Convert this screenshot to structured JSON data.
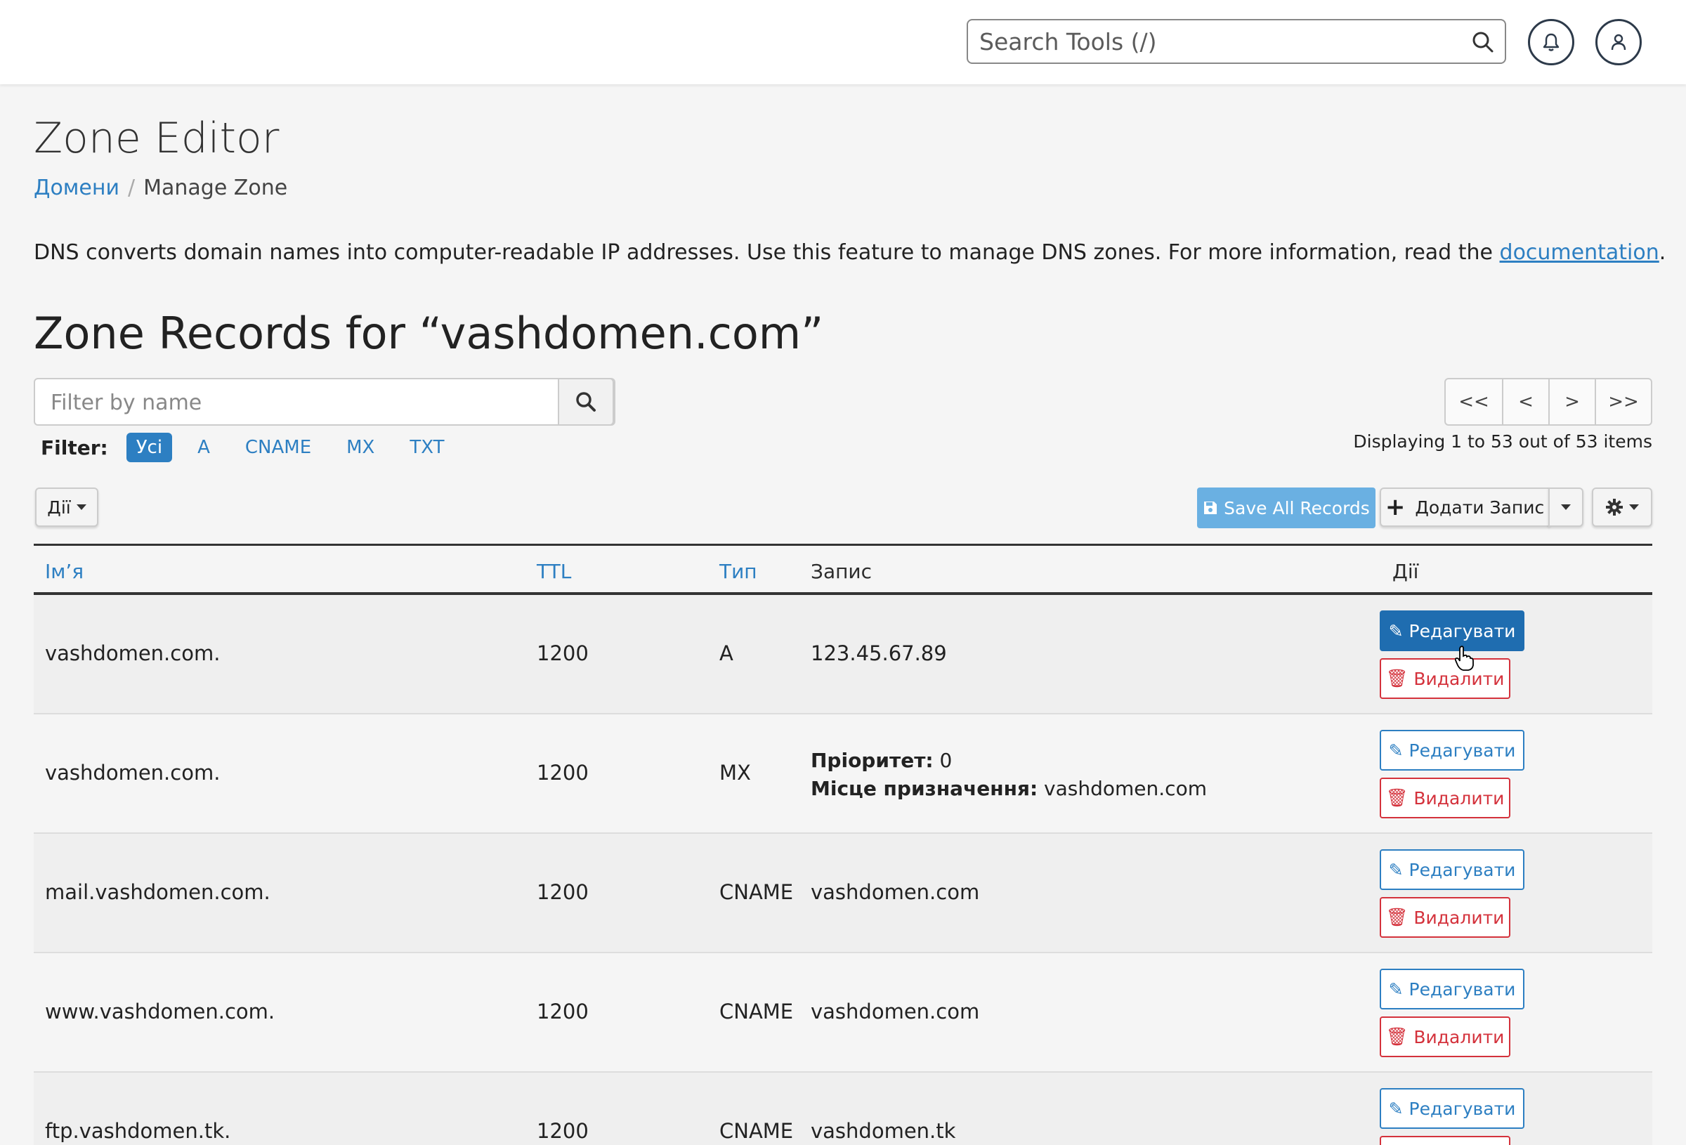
{
  "topbar": {
    "search_placeholder": "Search Tools (/)",
    "search_icon": "search-icon",
    "bell_icon": "bell-icon",
    "user_icon": "user-icon"
  },
  "page": {
    "title": "Zone Editor",
    "breadcrumb": {
      "link": "Домени",
      "separator": "/",
      "current": "Manage Zone"
    },
    "description": "DNS converts domain names into computer-readable IP addresses. Use this feature to manage DNS zones. For more information, read the ",
    "description_link": "documentation",
    "description_end": ".",
    "records_heading": "Zone Records for “vashdomen.com”"
  },
  "filter": {
    "placeholder": "Filter by name",
    "label": "Filter:",
    "pills": [
      "Усі",
      "A",
      "CNAME",
      "MX",
      "TXT"
    ],
    "active_pill": "Усі"
  },
  "pager": {
    "first": "<<",
    "prev": "<",
    "next": ">",
    "last": ">>",
    "displaying": "Displaying 1 to 53 out of 53 items"
  },
  "toolbar": {
    "actions_label": "Дії",
    "save_all": "Save All Records",
    "add_record": "Додати Запис"
  },
  "table": {
    "headers": {
      "name": "Ім’я",
      "ttl": "TTL",
      "type": "Тип",
      "record": "Запис",
      "actions": "Дії"
    },
    "edit_label": "Редагувати",
    "delete_label": "Видалити",
    "rows": [
      {
        "name": "vashdomen.com.",
        "ttl": "1200",
        "type": "A",
        "record": "123.45.67.89"
      },
      {
        "name": "vashdomen.com.",
        "ttl": "1200",
        "type": "MX",
        "priority_label": "Пріоритет:",
        "priority": " 0",
        "dest_label": "Місце призначення:",
        "dest": " vashdomen.com"
      },
      {
        "name": "mail.vashdomen.com.",
        "ttl": "1200",
        "type": "CNAME",
        "record": "vashdomen.com"
      },
      {
        "name": "www.vashdomen.com.",
        "ttl": "1200",
        "type": "CNAME",
        "record": "vashdomen.com"
      },
      {
        "name": "ftp.vashdomen.tk.",
        "ttl": "1200",
        "type": "CNAME",
        "record": "vashdomen.tk"
      }
    ]
  },
  "colors": {
    "accent": "#2d7fc2",
    "primary": "#1f6db0",
    "danger": "#d4323c",
    "save": "#6ab0e2"
  }
}
